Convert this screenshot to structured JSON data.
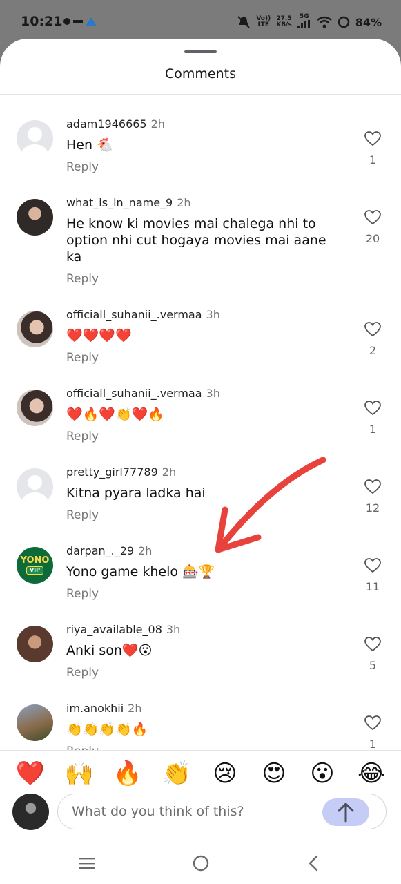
{
  "status_bar": {
    "time": "10:21",
    "network_top": "Vo))",
    "network_bottom": "LTE",
    "speed_top": "27.5",
    "speed_bottom": "KB/s",
    "gen": "5G",
    "battery": "84%"
  },
  "sheet": {
    "title": "Comments"
  },
  "comments": [
    {
      "username": "adam1946665",
      "time": "2h",
      "text": "Hen 🐔",
      "reply_label": "Reply",
      "likes": "1"
    },
    {
      "username": "what_is_in_name_9",
      "time": "2h",
      "text": "He know ki movies mai chalega nhi to option nhi cut hogaya movies mai aane ka",
      "reply_label": "Reply",
      "likes": "20"
    },
    {
      "username": "officiall_suhanii_.vermaa",
      "time": "3h",
      "text": "❤️❤️❤️❤️",
      "reply_label": "Reply",
      "likes": "2"
    },
    {
      "username": "officiall_suhanii_.vermaa",
      "time": "3h",
      "text": "❤️🔥❤️👏❤️🔥",
      "reply_label": "Reply",
      "likes": "1"
    },
    {
      "username": "pretty_girl77789",
      "time": "2h",
      "text": "Kitna pyara ladka hai",
      "reply_label": "Reply",
      "likes": "12"
    },
    {
      "username": "darpan_._29",
      "time": "2h",
      "text": "Yono game khelo 🎰🏆",
      "reply_label": "Reply",
      "likes": "11",
      "avatar_text_top": "YONO",
      "avatar_text_bottom": "VIP"
    },
    {
      "username": "riya_available_08",
      "time": "3h",
      "text": "Anki son❤️😮",
      "reply_label": "Reply",
      "likes": "5"
    },
    {
      "username": "im.anokhii",
      "time": "2h",
      "text": "👏👏👏👏🔥",
      "reply_label": "Reply",
      "likes": "1"
    }
  ],
  "quick_reactions": [
    "❤️",
    "🙌",
    "🔥",
    "👏",
    "😢",
    "😍",
    "😮",
    "😂"
  ],
  "composer": {
    "placeholder": "What do you think of this?"
  },
  "icons": {
    "like": "heart-outline-icon",
    "send": "arrow-up-icon",
    "nav": [
      "menu-icon",
      "home-circle-icon",
      "back-chevron-icon"
    ]
  },
  "colors": {
    "send_button": "#c5ccf5",
    "muted_text": "#767676",
    "annotation_arrow": "#e8423d"
  }
}
